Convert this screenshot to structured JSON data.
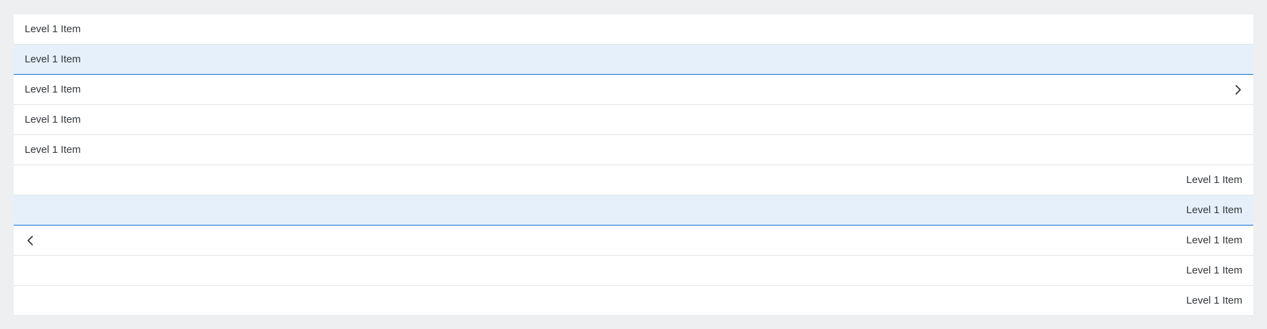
{
  "list": {
    "rows": [
      {
        "label": "Level 1 Item",
        "align": "left",
        "selected": false,
        "icon": ""
      },
      {
        "label": "Level 1 Item",
        "align": "left",
        "selected": true,
        "icon": ""
      },
      {
        "label": "Level 1 Item",
        "align": "left",
        "selected": false,
        "icon": "chevron-right-icon"
      },
      {
        "label": "Level 1 Item",
        "align": "left",
        "selected": false,
        "icon": ""
      },
      {
        "label": "Level 1 Item",
        "align": "left",
        "selected": false,
        "icon": ""
      },
      {
        "label": "Level 1 Item",
        "align": "right",
        "selected": false,
        "icon": ""
      },
      {
        "label": "Level 1 Item",
        "align": "right",
        "selected": true,
        "icon": ""
      },
      {
        "label": "Level 1 Item",
        "align": "right",
        "selected": false,
        "icon": "chevron-left-icon"
      },
      {
        "label": "Level 1 Item",
        "align": "right",
        "selected": false,
        "icon": ""
      },
      {
        "label": "Level 1 Item",
        "align": "right",
        "selected": false,
        "icon": ""
      }
    ]
  },
  "colors": {
    "page_background": "#edeff0",
    "row_background": "#ffffff",
    "selected_background": "#e5f0fa",
    "selected_border": "#0a6ed1",
    "text": "#32363a",
    "divider": "#e5e5e5"
  }
}
